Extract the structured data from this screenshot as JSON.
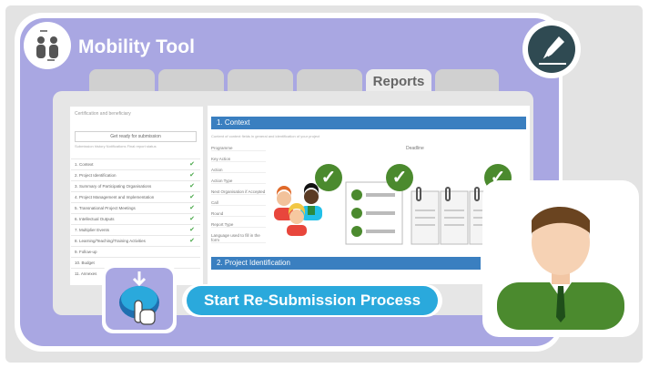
{
  "app": {
    "title": "Mobility Tool"
  },
  "tabs": {
    "active_label": "Reports"
  },
  "left_panel": {
    "top_text": "Certification and beneficiary",
    "button_label": "Get ready for submission",
    "sub_text": "Submission history   Notifications   Final report status",
    "items": [
      {
        "label": "1. Context",
        "checked": true
      },
      {
        "label": "2. Project Identification",
        "checked": true
      },
      {
        "label": "3. Summary of Participating Organisations",
        "checked": true
      },
      {
        "label": "4. Project Management and Implementation",
        "checked": true
      },
      {
        "label": "5. Transnational Project Meetings",
        "checked": true
      },
      {
        "label": "6. Intellectual Outputs",
        "checked": true
      },
      {
        "label": "7. Multiplier Events",
        "checked": true
      },
      {
        "label": "8. Learning/Teaching/Training Activities",
        "checked": true
      },
      {
        "label": "9. Follow-up",
        "checked": false
      },
      {
        "label": "10. Budget",
        "checked": false
      },
      {
        "label": "11. Annexes",
        "checked": false
      }
    ]
  },
  "main_panel": {
    "section1_title": "1. Context",
    "section1_desc": "Content of context fields in general and identification of your project",
    "row_labels": [
      "Programme",
      "Key Action",
      "Action",
      "Action Type",
      "Next Organisation if Accepted",
      "Call",
      "Round",
      "Report Type",
      "Language used to fill in the form"
    ],
    "right_label": "Deadline",
    "section2_title": "2. Project Identification"
  },
  "action": {
    "resubmit_label": "Start Re-Submission Process"
  },
  "icons": [
    "mobility-logo-icon",
    "pen-icon",
    "team-icon",
    "checklist-icon",
    "documents-icon",
    "checkmark-icon",
    "hand-pointer-icon",
    "user-avatar-icon"
  ],
  "colors": {
    "lavender": "#a9a7e2",
    "section_blue": "#3a7fc0",
    "button_blue": "#2aa9dc",
    "check_green": "#4b8a2e"
  }
}
